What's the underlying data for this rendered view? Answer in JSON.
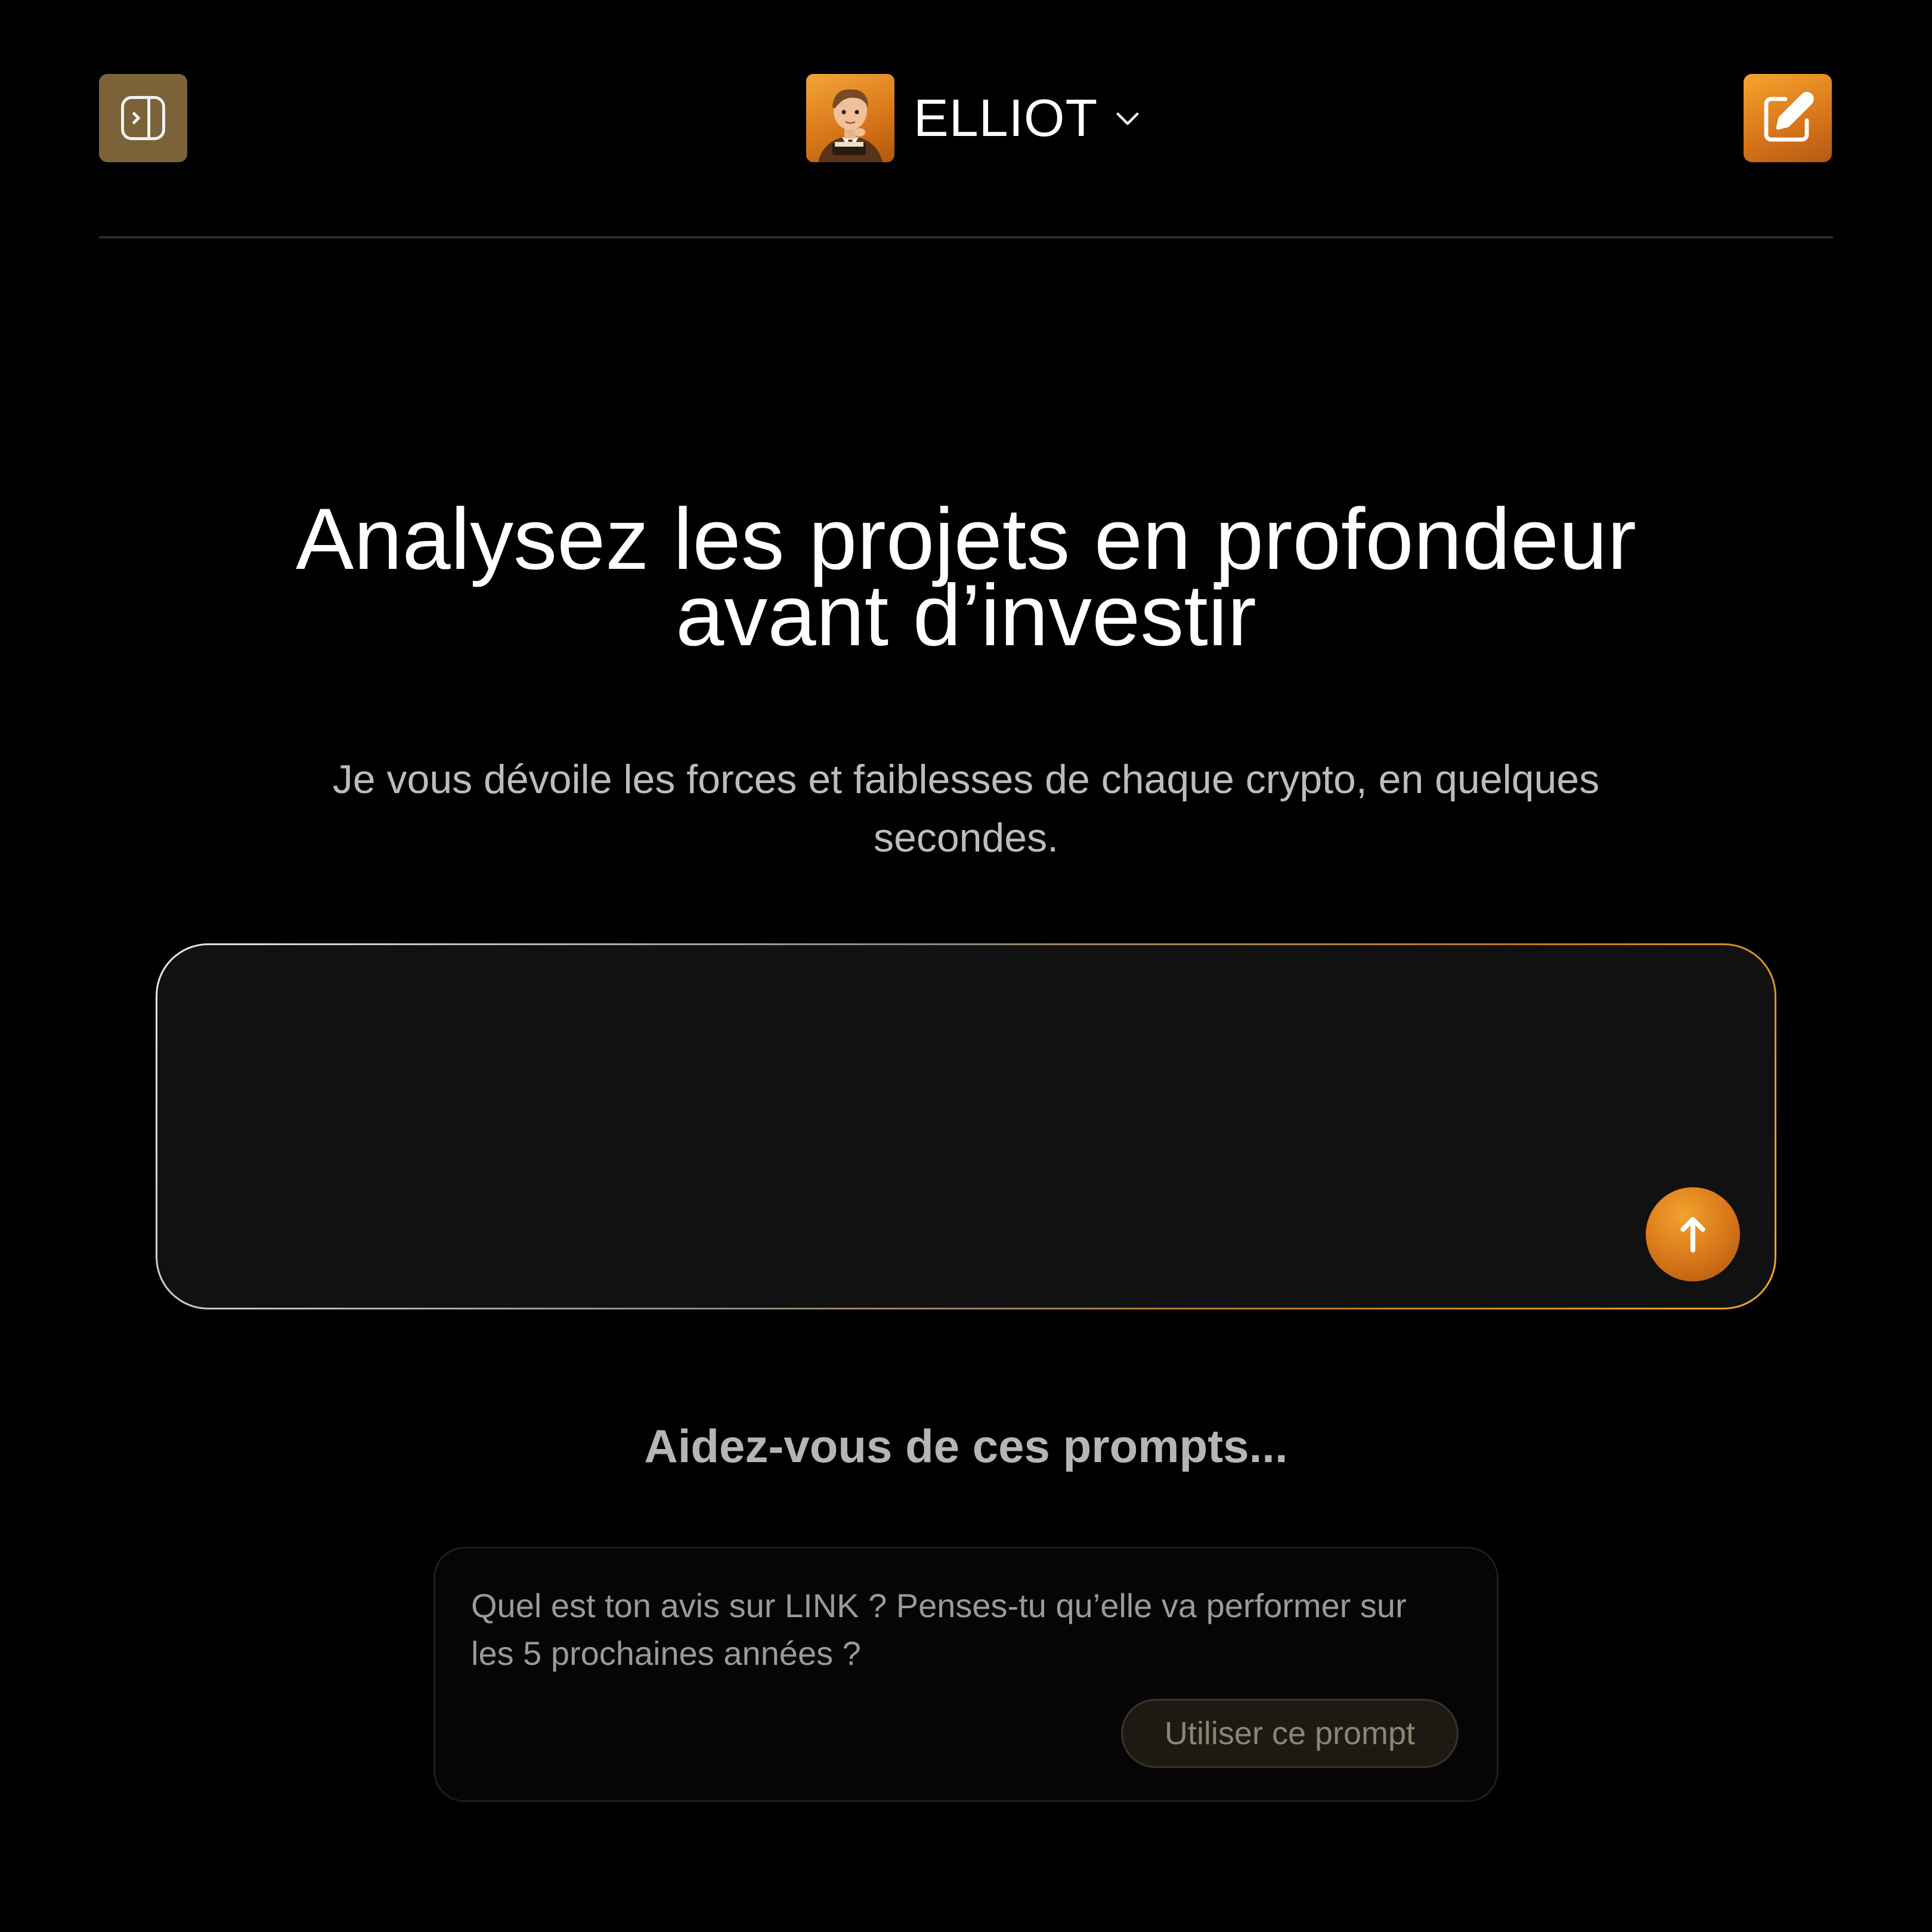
{
  "header": {
    "agent_name": "ELLIOT"
  },
  "hero": {
    "title_line1": "Analysez les projets en profondeur",
    "title_line2": "avant d’investir",
    "subtitle": "Je vous dévoile les forces et faiblesses de chaque crypto, en quelques secondes."
  },
  "prompt": {
    "value": "",
    "placeholder": ""
  },
  "suggestions": {
    "heading": "Aidez-vous de ces prompts...",
    "items": [
      {
        "text": "Quel est ton avis sur LINK ? Penses-tu qu’elle va performer sur les 5 prochaines années ?",
        "button_label": "Utiliser ce prompt"
      }
    ]
  },
  "colors": {
    "background": "#000000",
    "accent": "#f5a52b",
    "accent_dark": "#d6741a",
    "sidebar_button": "#7b6238",
    "input_bg": "#111111"
  },
  "icons": {
    "sidebar_toggle": "sidebar-expand-icon",
    "agent_avatar": "avatar",
    "agent_dropdown": "chevron-down-icon",
    "new_chat": "edit-icon",
    "send": "arrow-up-icon"
  }
}
